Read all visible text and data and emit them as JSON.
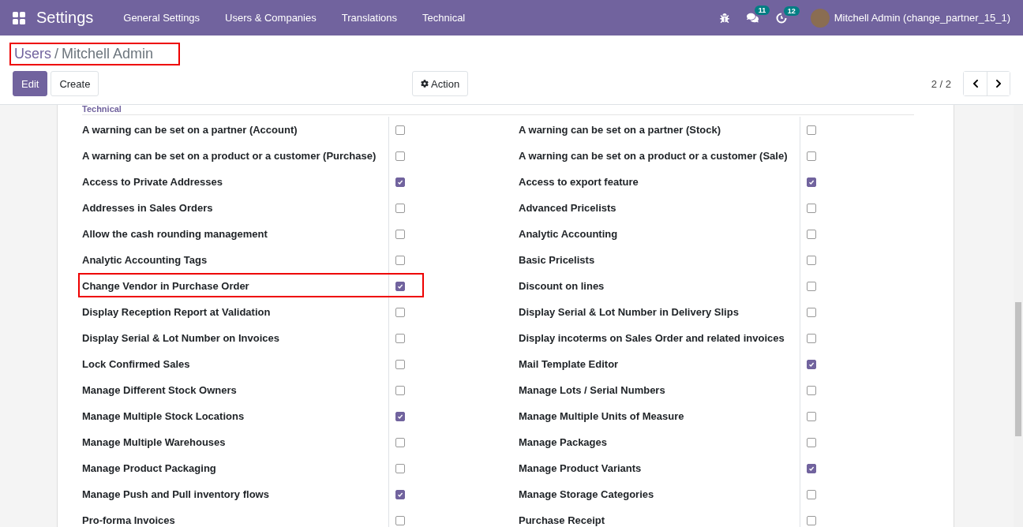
{
  "navbar": {
    "app_title": "Settings",
    "menu": [
      "General Settings",
      "Users & Companies",
      "Translations",
      "Technical"
    ],
    "messages_badge": "11",
    "activities_badge": "12",
    "user": "Mitchell Admin (change_partner_15_1)"
  },
  "breadcrumb": {
    "parent": "Users",
    "separator": "/",
    "current": "Mitchell Admin",
    "highlighted": true
  },
  "buttons": {
    "edit": "Edit",
    "create": "Create",
    "action": "Action"
  },
  "pager": {
    "value": "2 / 2"
  },
  "section": {
    "title": "Technical"
  },
  "settings": [
    {
      "left": {
        "label": "A warning can be set on a partner (Account)",
        "checked": false,
        "highlighted": false
      },
      "right": {
        "label": "A warning can be set on a partner (Stock)",
        "checked": false
      }
    },
    {
      "left": {
        "label": "A warning can be set on a product or a customer (Purchase)",
        "checked": false,
        "highlighted": false
      },
      "right": {
        "label": "A warning can be set on a product or a customer (Sale)",
        "checked": false
      }
    },
    {
      "left": {
        "label": "Access to Private Addresses",
        "checked": true,
        "highlighted": false
      },
      "right": {
        "label": "Access to export feature",
        "checked": true
      }
    },
    {
      "left": {
        "label": "Addresses in Sales Orders",
        "checked": false,
        "highlighted": false
      },
      "right": {
        "label": "Advanced Pricelists",
        "checked": false
      }
    },
    {
      "left": {
        "label": "Allow the cash rounding management",
        "checked": false,
        "highlighted": false
      },
      "right": {
        "label": "Analytic Accounting",
        "checked": false
      }
    },
    {
      "left": {
        "label": "Analytic Accounting Tags",
        "checked": false,
        "highlighted": false
      },
      "right": {
        "label": "Basic Pricelists",
        "checked": false
      }
    },
    {
      "left": {
        "label": "Change Vendor in Purchase Order",
        "checked": true,
        "highlighted": true
      },
      "right": {
        "label": "Discount on lines",
        "checked": false
      }
    },
    {
      "left": {
        "label": "Display Reception Report at Validation",
        "checked": false,
        "highlighted": false
      },
      "right": {
        "label": "Display Serial & Lot Number in Delivery Slips",
        "checked": false
      }
    },
    {
      "left": {
        "label": "Display Serial & Lot Number on Invoices",
        "checked": false,
        "highlighted": false
      },
      "right": {
        "label": "Display incoterms on Sales Order and related invoices",
        "checked": false
      }
    },
    {
      "left": {
        "label": "Lock Confirmed Sales",
        "checked": false,
        "highlighted": false
      },
      "right": {
        "label": "Mail Template Editor",
        "checked": true
      }
    },
    {
      "left": {
        "label": "Manage Different Stock Owners",
        "checked": false,
        "highlighted": false
      },
      "right": {
        "label": "Manage Lots / Serial Numbers",
        "checked": false
      }
    },
    {
      "left": {
        "label": "Manage Multiple Stock Locations",
        "checked": true,
        "highlighted": false
      },
      "right": {
        "label": "Manage Multiple Units of Measure",
        "checked": false
      }
    },
    {
      "left": {
        "label": "Manage Multiple Warehouses",
        "checked": false,
        "highlighted": false
      },
      "right": {
        "label": "Manage Packages",
        "checked": false
      }
    },
    {
      "left": {
        "label": "Manage Product Packaging",
        "checked": false,
        "highlighted": false
      },
      "right": {
        "label": "Manage Product Variants",
        "checked": true
      }
    },
    {
      "left": {
        "label": "Manage Push and Pull inventory flows",
        "checked": true,
        "highlighted": false
      },
      "right": {
        "label": "Manage Storage Categories",
        "checked": false
      }
    },
    {
      "left": {
        "label": "Pro-forma Invoices",
        "checked": false,
        "highlighted": false
      },
      "right": {
        "label": "Purchase Receipt",
        "checked": false
      }
    }
  ]
}
